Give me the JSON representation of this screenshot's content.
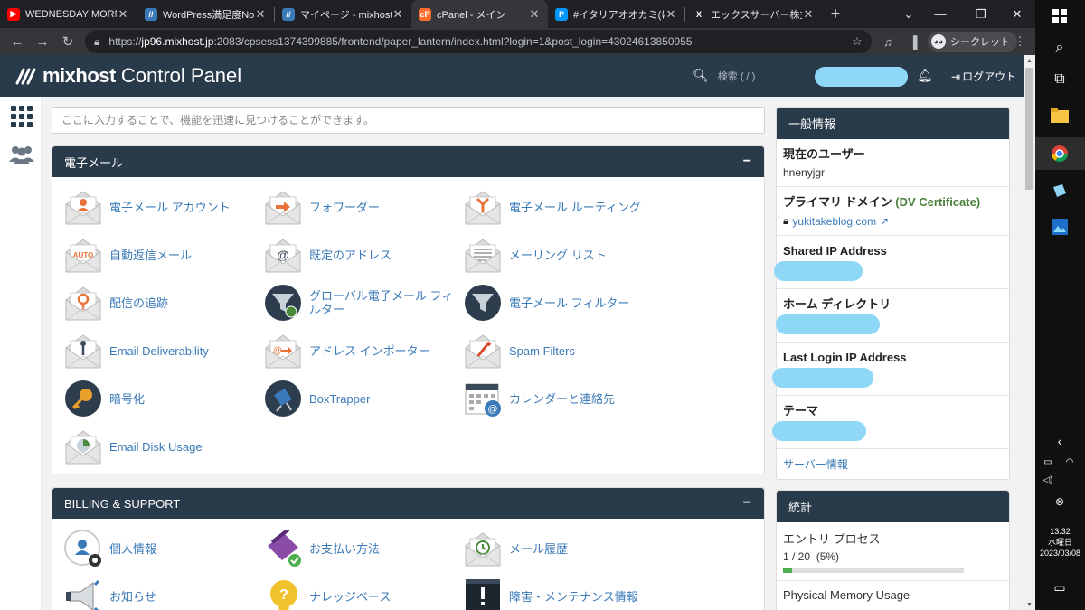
{
  "browser": {
    "tabs": [
      {
        "title": "WEDNESDAY MORN",
        "favicon": "youtube-icon",
        "color": "#ff0000",
        "active": false
      },
      {
        "title": "WordPress満足度No",
        "favicon": "mixhost-icon",
        "color": "#3b7ab8",
        "active": false
      },
      {
        "title": "マイページ - mixhost",
        "favicon": "mixhost-icon",
        "color": "#3b7ab8",
        "active": false
      },
      {
        "title": "cPanel - メイン",
        "favicon": "cpanel-icon",
        "color": "#ff6c2c",
        "active": true
      },
      {
        "title": "#イタリアオオカミ(けもの",
        "favicon": "pixiv-icon",
        "color": "#0096fa",
        "active": false
      },
      {
        "title": "エックスサーバー株式会",
        "favicon": "x-icon",
        "color": "#ffffff",
        "active": false
      }
    ],
    "url_prefix": "https://",
    "url_host": "jp96.mixhost.jp",
    "url_rest": ":2083/cpsess1374399885/frontend/paper_lantern/index.html?login=1&post_login=43024613850955",
    "incognito_label": "シークレット"
  },
  "header": {
    "brand": "mixhost",
    "product": "Control Panel",
    "search_label": "検索 ( / )",
    "logout_label": "ログアウト"
  },
  "main": {
    "search_placeholder": "ここに入力することで、機能を迅速に見つけることができます。",
    "sections": [
      {
        "title": "電子メール",
        "collapse": "−",
        "items": [
          {
            "label": "電子メール アカウント",
            "icon": "email-account-icon"
          },
          {
            "label": "フォワーダー",
            "icon": "forwarder-icon"
          },
          {
            "label": "電子メール ルーティング",
            "icon": "email-routing-icon"
          },
          {
            "label": "自動返信メール",
            "icon": "autoresponder-icon"
          },
          {
            "label": "既定のアドレス",
            "icon": "default-address-icon"
          },
          {
            "label": "メーリング リスト",
            "icon": "mailing-list-icon"
          },
          {
            "label": "配信の追跡",
            "icon": "track-delivery-icon"
          },
          {
            "label": "グローバル電子メール フィルター",
            "icon": "global-filter-icon"
          },
          {
            "label": "電子メール フィルター",
            "icon": "email-filter-icon"
          },
          {
            "label": "Email Deliverability",
            "icon": "deliverability-icon"
          },
          {
            "label": "アドレス インポーター",
            "icon": "address-importer-icon"
          },
          {
            "label": "Spam Filters",
            "icon": "spam-filters-icon"
          },
          {
            "label": "暗号化",
            "icon": "encryption-icon"
          },
          {
            "label": "BoxTrapper",
            "icon": "boxtrapper-icon"
          },
          {
            "label": "カレンダーと連絡先",
            "icon": "calendar-contacts-icon"
          },
          {
            "label": "Email Disk Usage",
            "icon": "disk-usage-icon"
          }
        ]
      },
      {
        "title": "BILLING & SUPPORT",
        "collapse": "−",
        "items": [
          {
            "label": "個人情報",
            "icon": "personal-info-icon"
          },
          {
            "label": "お支払い方法",
            "icon": "payment-method-icon"
          },
          {
            "label": "メール履歴",
            "icon": "mail-history-icon"
          },
          {
            "label": "お知らせ",
            "icon": "announcements-icon"
          },
          {
            "label": "ナレッジベース",
            "icon": "knowledge-base-icon"
          },
          {
            "label": "障害・メンテナンス情報",
            "icon": "maintenance-info-icon"
          }
        ]
      }
    ]
  },
  "sidebar": {
    "general_title": "一般情報",
    "current_user_label": "現在のユーザー",
    "current_user_value": "hnenyjgr",
    "primary_domain_label": "プライマリ ドメイン",
    "primary_domain_cert": "(DV Certificate)",
    "primary_domain_value": "yukitakeblog.com",
    "shared_ip_label": "Shared IP Address",
    "home_dir_label": "ホーム ディレクトリ",
    "last_login_label": "Last Login IP Address",
    "theme_label": "テーマ",
    "server_info_link": "サーバー情報",
    "stats_title": "統計",
    "entry_process_label": "エントリ プロセス",
    "entry_process_value": "1 / 20  (5%)",
    "entry_process_percent": 5,
    "physical_memory_label": "Physical Memory Usage"
  },
  "taskbar": {
    "time": "13:32",
    "day": "水曜日",
    "date": "2023/03/08"
  }
}
